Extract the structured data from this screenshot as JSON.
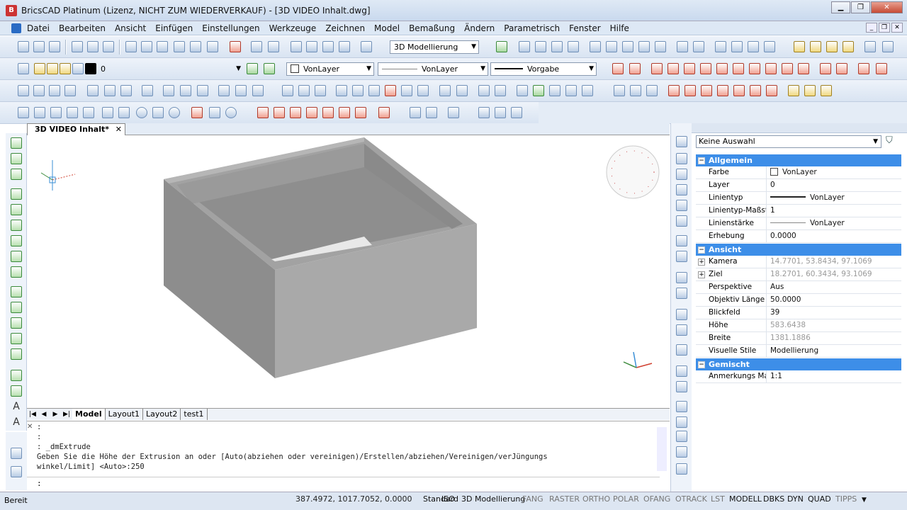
{
  "window": {
    "title": "BricsCAD Platinum (Lizenz, NICHT ZUM WIEDERVERKAUF) - [3D VIDEO Inhalt.dwg]"
  },
  "menu": [
    "Datei",
    "Bearbeiten",
    "Ansicht",
    "Einfügen",
    "Einstellungen",
    "Werkzeuge",
    "Zeichnen",
    "Model",
    "Bemaßung",
    "Ändern",
    "Parametrisch",
    "Fenster",
    "Hilfe"
  ],
  "toolbar": {
    "workspace": "3D Modellierung",
    "layer": "0",
    "color": "VonLayer",
    "linetype": "VonLayer",
    "lineweight": "Vorgabe"
  },
  "document_tab": {
    "label": "3D VIDEO Inhalt*",
    "close": "✕"
  },
  "layout_tabs": [
    "Model",
    "Layout1",
    "Layout2",
    "test1"
  ],
  "command": {
    "lines": [
      ":",
      ": _dmExtrude",
      "Geben Sie die Höhe der Extrusion an oder [Auto(abziehen oder vereinigen)/Erstellen/abziehen/Vereinigen/verJüngungs",
      "winkel/Limit] <Auto>:250"
    ],
    "prompt": ":"
  },
  "properties": {
    "selection": "Keine Auswahl",
    "groups": [
      {
        "name": "Allgemein",
        "rows": [
          {
            "name": "Farbe",
            "value": "VonLayer",
            "kind": "color"
          },
          {
            "name": "Layer",
            "value": "0"
          },
          {
            "name": "Linientyp",
            "value": "VonLayer",
            "kind": "linetype"
          },
          {
            "name": "Linientyp-Maßstab",
            "value": "1"
          },
          {
            "name": "Linienstärke",
            "value": "VonLayer",
            "kind": "lineweight"
          },
          {
            "name": "Erhebung",
            "value": "0.0000"
          }
        ]
      },
      {
        "name": "Ansicht",
        "rows": [
          {
            "name": "Kamera",
            "value": "14.7701, 53.8434, 97.1069",
            "gray": true,
            "expand": true
          },
          {
            "name": "Ziel",
            "value": "18.2701, 60.3434, 93.1069",
            "gray": true,
            "expand": true
          },
          {
            "name": "Perspektive",
            "value": "Aus"
          },
          {
            "name": "Objektiv Länge",
            "value": "50.0000"
          },
          {
            "name": "Blickfeld",
            "value": "39"
          },
          {
            "name": "Höhe",
            "value": "583.6438",
            "gray": true
          },
          {
            "name": "Breite",
            "value": "1381.1886",
            "gray": true
          },
          {
            "name": "Visuelle Stile",
            "value": "Modellierung"
          }
        ]
      },
      {
        "name": "Gemischt",
        "rows": [
          {
            "name": "Anmerkungs Maßstab",
            "value": "1:1"
          }
        ]
      }
    ]
  },
  "status": {
    "ready": "Bereit",
    "coords": "387.4972, 1017.7052, 0.0000",
    "items": [
      {
        "label": "Standard",
        "on": true
      },
      {
        "label": "ISO",
        "on": true
      },
      {
        "label": "3D Modellierung",
        "on": true
      },
      {
        "label": "FANG",
        "on": false
      },
      {
        "label": "RASTER",
        "on": false
      },
      {
        "label": "ORTHO",
        "on": false
      },
      {
        "label": "POLAR",
        "on": false
      },
      {
        "label": "OFANG",
        "on": false
      },
      {
        "label": "OTRACK",
        "on": false
      },
      {
        "label": "LST",
        "on": false
      },
      {
        "label": "MODELL",
        "on": true
      },
      {
        "label": "DBKS",
        "on": true
      },
      {
        "label": "DYN",
        "on": true
      },
      {
        "label": "QUAD",
        "on": true
      },
      {
        "label": "TIPPS",
        "on": false
      }
    ]
  }
}
